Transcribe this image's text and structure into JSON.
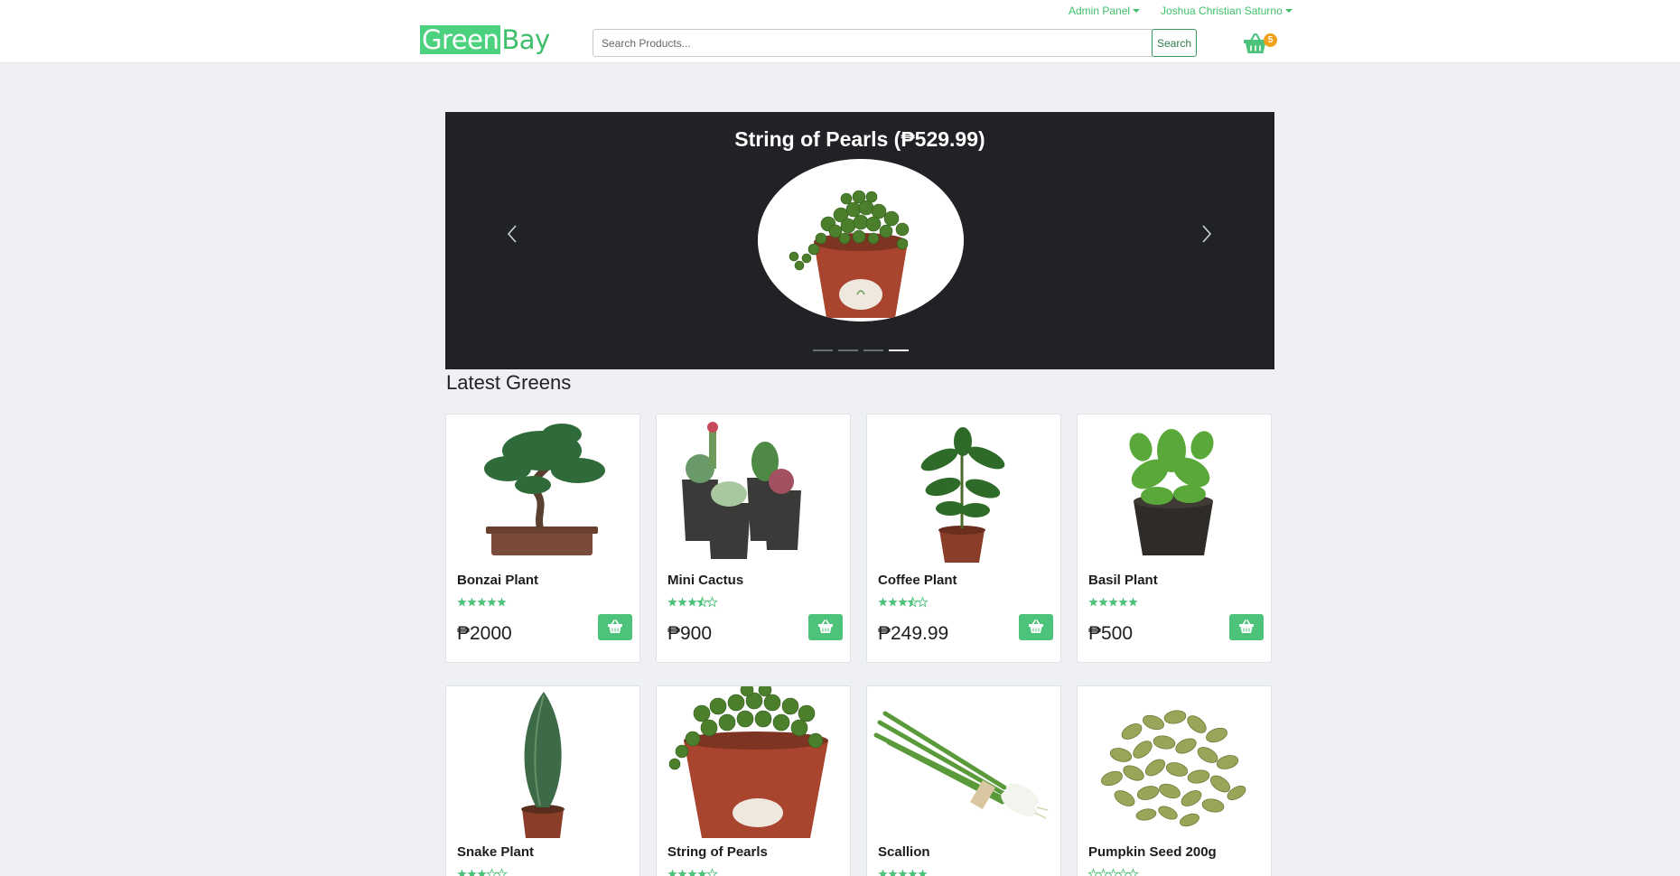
{
  "header": {
    "logo_part1": "Green",
    "logo_part2": "Bay",
    "admin_label": "Admin Panel",
    "user_label": "Joshua Christian Saturno",
    "search_placeholder": "Search Products...",
    "search_button": "Search",
    "cart_count": "5"
  },
  "carousel": {
    "title": "String of Pearls (₱529.99)",
    "slide_count": 4,
    "active_slide": 4
  },
  "section": {
    "title": "Latest Greens"
  },
  "products": [
    {
      "name": "Bonzai Plant",
      "price": "₱2000",
      "rating": 5,
      "image": "bonsai-tree"
    },
    {
      "name": "Mini Cactus",
      "price": "₱900",
      "rating": 3.5,
      "image": "cactus-pots"
    },
    {
      "name": "Coffee Plant",
      "price": "₱249.99",
      "rating": 3.5,
      "image": "coffee-plant"
    },
    {
      "name": "Basil Plant",
      "price": "₱500",
      "rating": 5,
      "image": "basil-plant"
    },
    {
      "name": "Snake Plant",
      "price": "",
      "rating": 3,
      "image": "snake-plant"
    },
    {
      "name": "String of Pearls",
      "price": "",
      "rating": 4,
      "image": "string-of-pearls"
    },
    {
      "name": "Scallion",
      "price": "",
      "rating": 5,
      "image": "scallion"
    },
    {
      "name": "Pumpkin Seed 200g",
      "price": "",
      "rating": 0,
      "image": "pumpkin-seeds"
    }
  ],
  "colors": {
    "brand_green": "#4cc27a",
    "link_green": "#3fbf6a",
    "badge_orange": "#f0a21b",
    "carousel_bg": "#202226",
    "page_bg": "#eef0f4"
  }
}
